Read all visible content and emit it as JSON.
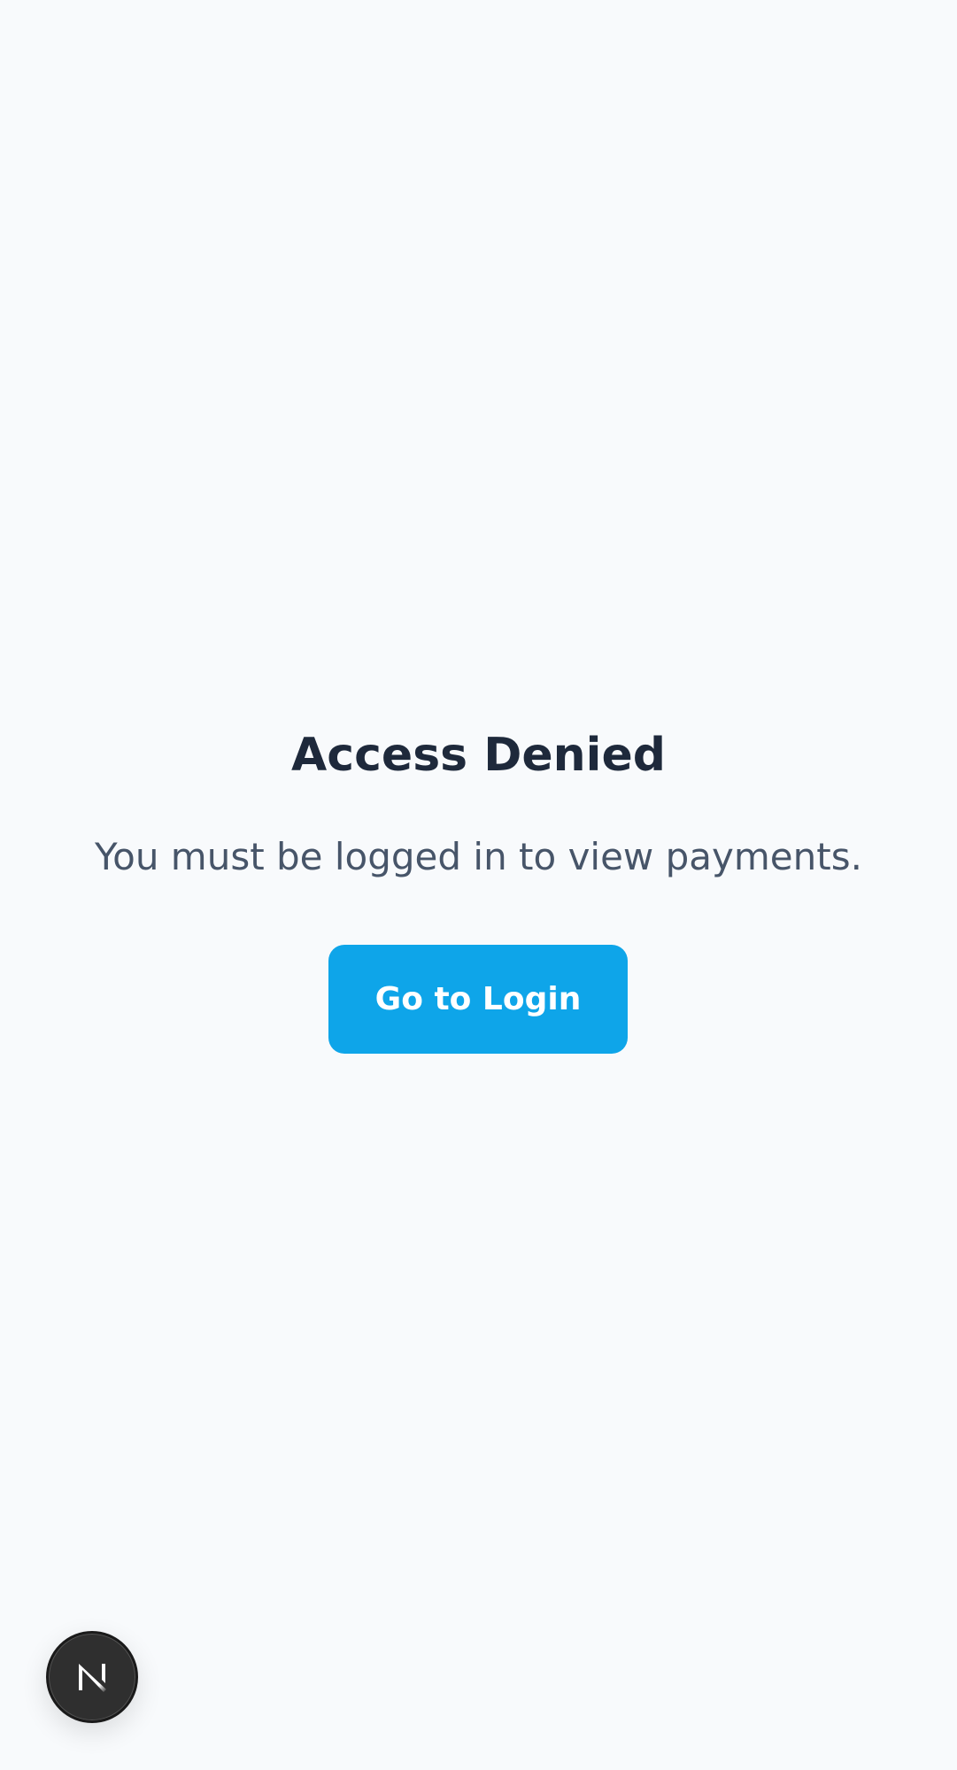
{
  "page": {
    "background_color": "#f8fafc"
  },
  "main": {
    "title": "Access Denied",
    "message": "You must be logged in to view payments.",
    "login_button_label": "Go to Login",
    "accent_color": "#0ea5e9"
  },
  "dev_badge": {
    "icon": "next-logo-icon",
    "letter": "N"
  }
}
